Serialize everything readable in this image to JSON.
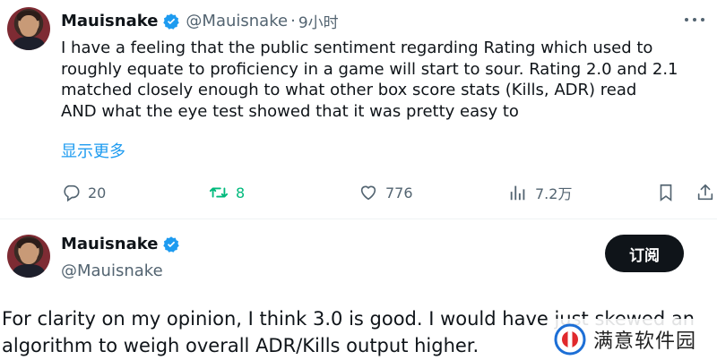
{
  "tweet1": {
    "display_name": "Mauisnake",
    "handle": "@Mauisnake",
    "separator": "·",
    "time": "9小时",
    "lines": [
      "I have a feeling that the public sentiment regarding Rating which used to",
      "roughly equate to proficiency in a game will start to sour. Rating 2.0 and 2.1",
      "matched closely enough to what other box score stats (Kills, ADR) read",
      "AND what the eye test showed that it was pretty easy to"
    ],
    "show_more": "显示更多",
    "actions": {
      "replies": "20",
      "retweets": "8",
      "likes": "776",
      "views": "7.2万"
    }
  },
  "tweet2": {
    "display_name": "Mauisnake",
    "handle": "@Mauisnake",
    "subscribe_label": "订阅",
    "lines": [
      "For clarity on my opinion, I think 3.0 is good. I would have just skewed an",
      "algorithm to weigh overall ADR/Kills output higher."
    ]
  },
  "watermark": {
    "text": "满意软件园"
  },
  "colors": {
    "text": "#0f1419",
    "secondary": "#536471",
    "accent": "#1d9bf0",
    "retweet": "#00ba7c",
    "button_bg": "#0f1419"
  }
}
